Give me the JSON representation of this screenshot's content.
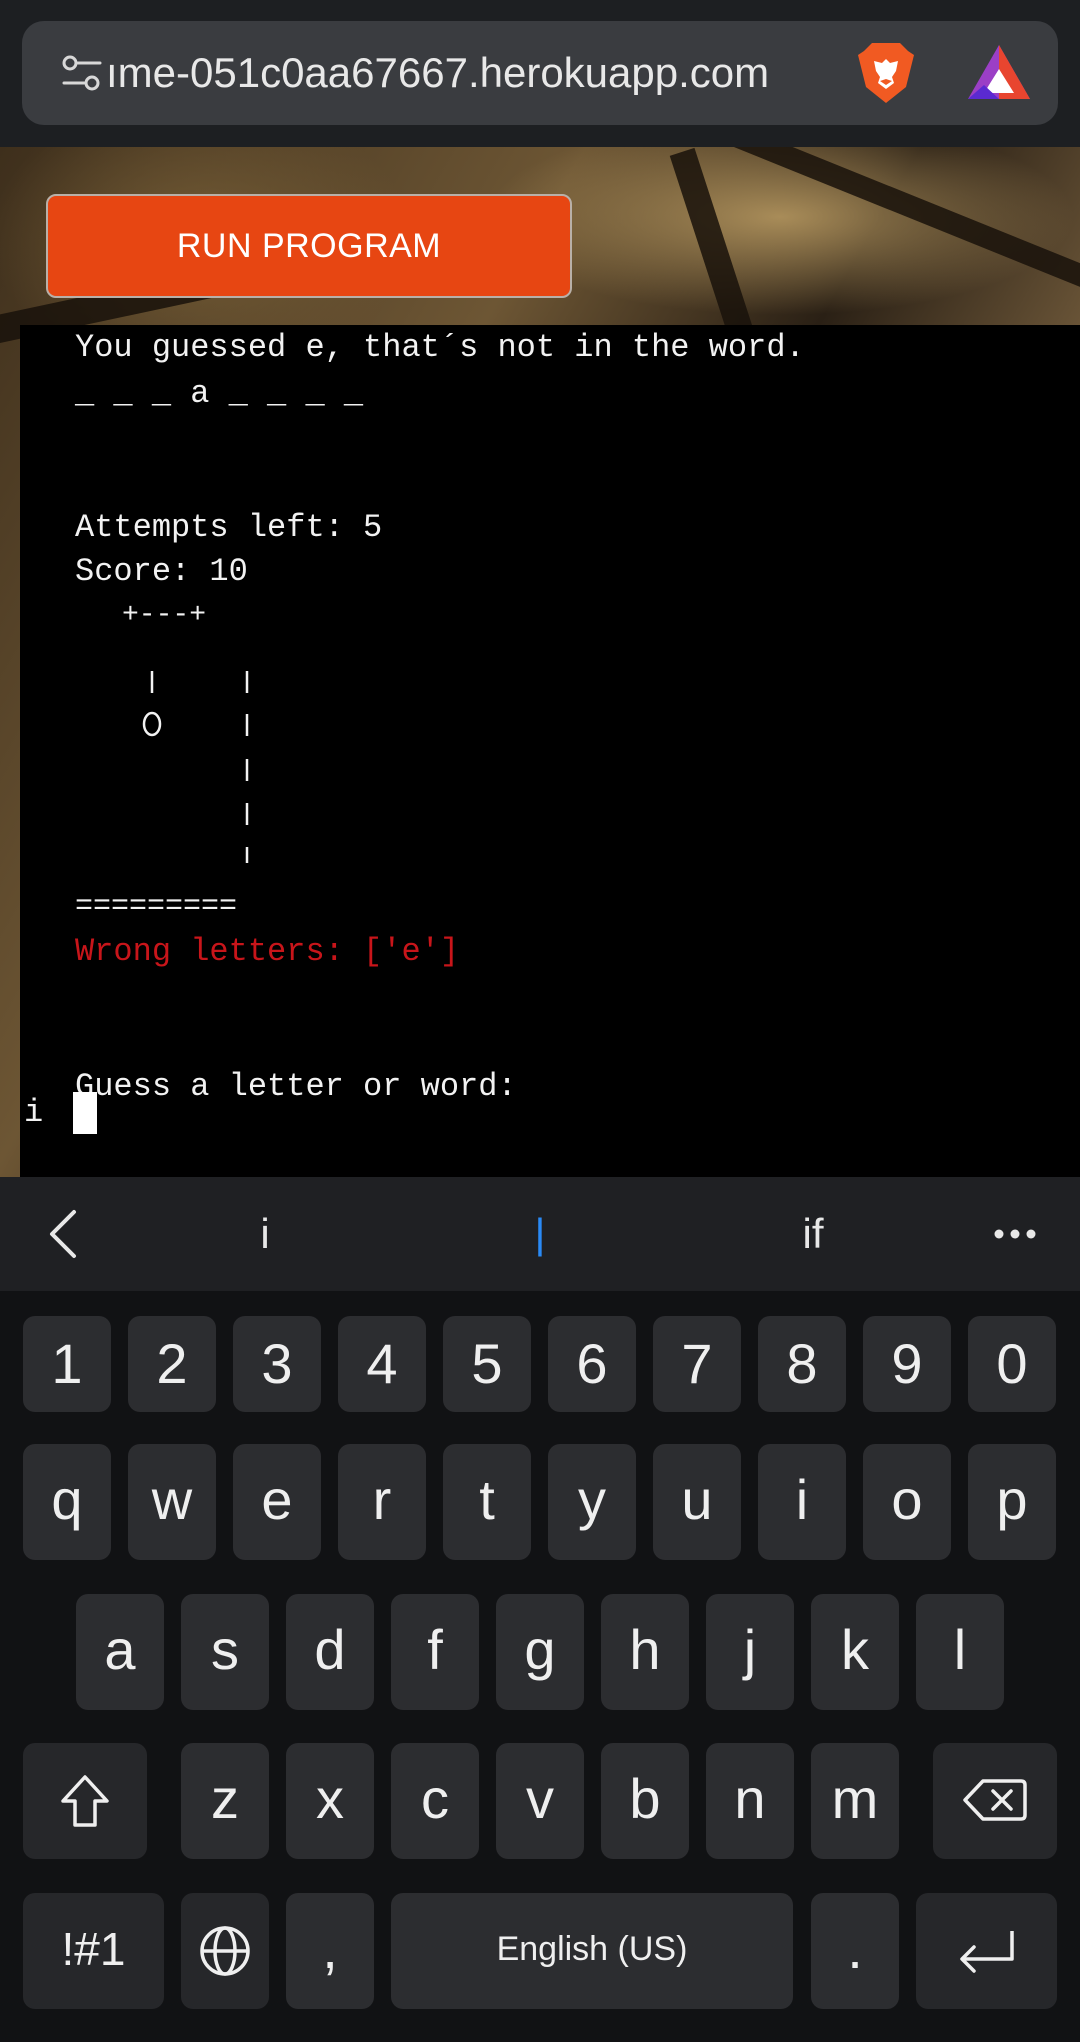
{
  "browser": {
    "url": "ıme-051c0aa67667.herokuapp.com",
    "icons": [
      "site-settings-icon",
      "brave-lion-icon",
      "brave-rewards-icon"
    ]
  },
  "page": {
    "run_button_label": "RUN PROGRAM",
    "accent_color": "#e74612"
  },
  "terminal": {
    "message": "You guessed e, that´s not in the word.",
    "word_progress": "_ _ _ a _ _ _ _",
    "attempts_left": "Attempts left: 5",
    "score": "Score: 10",
    "gallows_top": "+---+",
    "gallows_base": "=========",
    "wrong_letters": "Wrong letters: ['e']",
    "prompt": "Guess a letter or word:",
    "typed_input": "i",
    "wrong_color": "#c8151a"
  },
  "keyboard": {
    "suggestions": [
      "i",
      "|",
      "if"
    ],
    "number_row": [
      "1",
      "2",
      "3",
      "4",
      "5",
      "6",
      "7",
      "8",
      "9",
      "0"
    ],
    "row1": [
      "q",
      "w",
      "e",
      "r",
      "t",
      "y",
      "u",
      "i",
      "o",
      "p"
    ],
    "row2": [
      "a",
      "s",
      "d",
      "f",
      "g",
      "h",
      "j",
      "k",
      "l"
    ],
    "row3": [
      "z",
      "x",
      "c",
      "v",
      "b",
      "n",
      "m"
    ],
    "symbols_key": "!#1",
    "comma_key": ",",
    "space_label": "English (US)",
    "period_key": "."
  }
}
